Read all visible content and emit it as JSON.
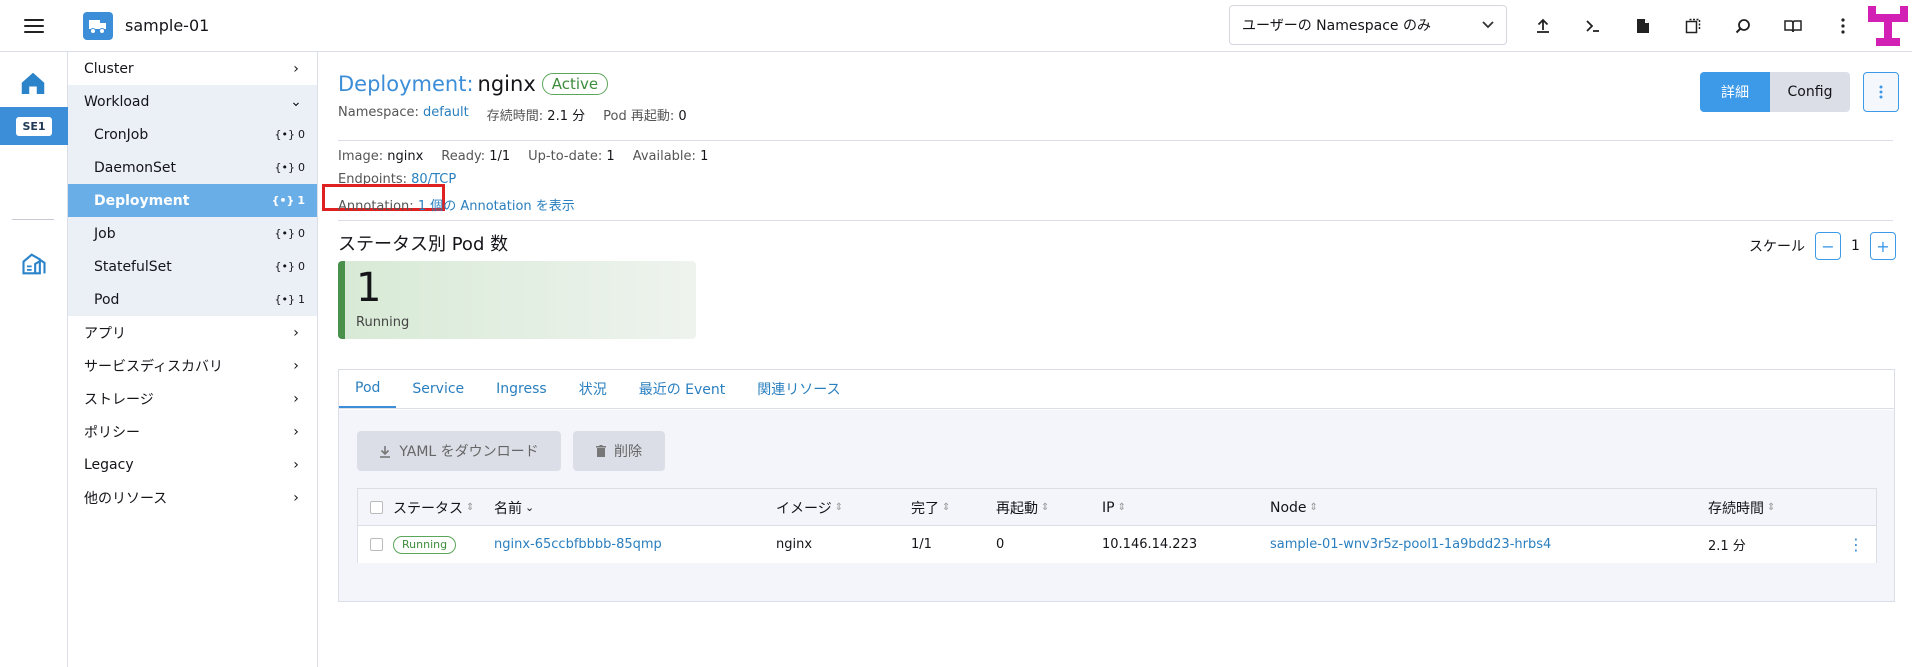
{
  "header": {
    "cluster_name": "sample-01",
    "namespace_select": "ユーザーの Namespace のみ",
    "icons": [
      "upload-icon",
      "terminal-icon",
      "file-icon",
      "copy-icon",
      "search-icon",
      "book-icon",
      "more-vertical-icon"
    ]
  },
  "rail": {
    "cluster_short": "SE1"
  },
  "sidemenu": {
    "cluster": "Cluster",
    "workload": "Workload",
    "items": [
      {
        "label": "CronJob",
        "count": "0"
      },
      {
        "label": "DaemonSet",
        "count": "0"
      },
      {
        "label": "Deployment",
        "count": "1"
      },
      {
        "label": "Job",
        "count": "0"
      },
      {
        "label": "StatefulSet",
        "count": "0"
      },
      {
        "label": "Pod",
        "count": "1"
      }
    ],
    "groups": [
      "アプリ",
      "サービスディスカバリ",
      "ストレージ",
      "ポリシー",
      "Legacy",
      "他のリソース"
    ]
  },
  "detail": {
    "type": "Deployment:",
    "name": "nginx",
    "state": "Active",
    "namespace_label": "Namespace:",
    "namespace_value": "default",
    "age_label": "存続時間:",
    "age_value": "2.1 分",
    "restarts_label": "Pod 再起動:",
    "restarts_value": "0",
    "detail_button": "詳細",
    "config_button": "Config"
  },
  "info": {
    "image_label": "Image:",
    "image_value": "nginx",
    "ready_label": "Ready:",
    "ready_value": "1/1",
    "uptodate_label": "Up-to-date:",
    "uptodate_value": "1",
    "available_label": "Available:",
    "available_value": "1",
    "endpoints_label": "Endpoints:",
    "endpoints_value": "80/TCP",
    "annotation_label": "Annotation:",
    "annotation_value": "1 個の Annotation を表示"
  },
  "pods_by_status": {
    "title": "ステータス別 Pod 数",
    "count": "1",
    "status": "Running",
    "scale_label": "スケール",
    "scale_value": "1",
    "minus": "−",
    "plus": "+"
  },
  "tabs": [
    "Pod",
    "Service",
    "Ingress",
    "状況",
    "最近の Event",
    "関連リソース"
  ],
  "toolbar": {
    "download_yaml": "YAML をダウンロード",
    "delete": "削除"
  },
  "table": {
    "headers": {
      "status": "ステータス",
      "name": "名前",
      "image": "イメージ",
      "complete": "完了",
      "restarts": "再起動",
      "ip": "IP",
      "node": "Node",
      "age": "存続時間"
    },
    "rows": [
      {
        "status": "Running",
        "name": "nginx-65ccbfbbbb-85qmp",
        "image": "nginx",
        "complete": "1/1",
        "restarts": "0",
        "ip": "10.146.14.223",
        "node": "sample-01-wnv3r5z-pool1-1a9bdd23-hrbs4",
        "age": "2.1 分"
      }
    ]
  },
  "colors": {
    "accent": "#3d8ed8",
    "primary_button": "#3d9ae8",
    "active_green": "#3c8c3c",
    "highlight_box": "#e02121"
  }
}
